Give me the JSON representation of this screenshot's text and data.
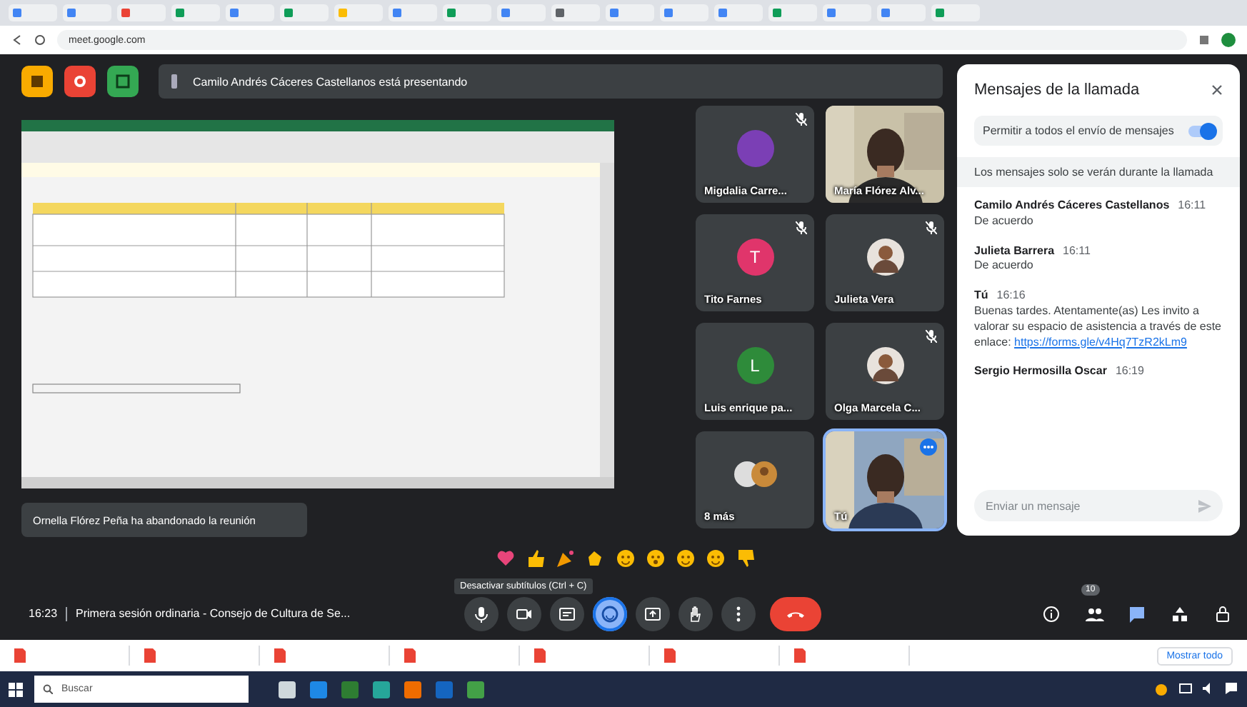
{
  "browser": {
    "url": "meet.google.com"
  },
  "presenting_banner": "Camilo Andrés Cáceres Castellanos está presentando",
  "tiles": [
    {
      "name": "Migdalia Carre...",
      "kind": "avatar",
      "color": "#7b3fb5",
      "muted": true
    },
    {
      "name": "María Flórez Alv...",
      "kind": "video",
      "muted": false
    },
    {
      "name": "Tito Farnes",
      "kind": "avatar",
      "initial": "T",
      "color": "#e0356b",
      "muted": true
    },
    {
      "name": "Julieta Vera",
      "muted": true
    },
    {
      "name": "Luis enrique pa...",
      "kind": "avatar",
      "initial": "L",
      "color": "#2e8b3a",
      "muted": false
    },
    {
      "name": "Olga Marcela C...",
      "muted": true
    },
    {
      "name": "8 más",
      "kind": "more",
      "muted": false
    },
    {
      "name": "Tú",
      "kind": "self",
      "muted": false
    }
  ],
  "notification": "Ornella Flórez Peña ha abandonado la reunión",
  "tooltip": "Desactivar subtítulos (Ctrl + C)",
  "meeting": {
    "time": "16:23",
    "title": "Primera sesión ordinaria - Consejo de Cultura de Se..."
  },
  "controls": [
    {
      "kind": "mic",
      "active": false
    },
    {
      "kind": "camera",
      "active": false
    },
    {
      "kind": "captions",
      "active": false
    },
    {
      "kind": "reactions",
      "active": true
    },
    {
      "kind": "present",
      "active": false
    },
    {
      "kind": "hand",
      "active": false
    },
    {
      "kind": "more",
      "active": false
    },
    {
      "kind": "end",
      "active": false
    }
  ],
  "side_buttons": [
    {
      "kind": "info",
      "active": false
    },
    {
      "kind": "people",
      "active": false,
      "badge": "10"
    },
    {
      "kind": "chat",
      "active": true
    },
    {
      "kind": "activities",
      "active": false
    },
    {
      "kind": "lock",
      "active": false
    }
  ],
  "chat": {
    "title": "Mensajes de la llamada",
    "allow_label": "Permitir a todos el envío de mensajes",
    "allow_on": true,
    "notice": "Los mensajes solo se verán durante la llamada",
    "messages": [
      {
        "sender": "Camilo Andrés Cáceres Castellanos",
        "time": "16:11",
        "text": "De acuerdo"
      },
      {
        "sender": "Julieta Barrera",
        "time": "16:11",
        "text": "De acuerdo"
      },
      {
        "sender": "Tú",
        "time": "16:16",
        "text": "Buenas tardes. Atentamente(as) Les invito a valorar su espacio de asistencia a través de este enlace:",
        "link": "https://forms.gle/v4Hq7TzR2kLm9"
      },
      {
        "sender": "Sergio Hermosilla Oscar",
        "time": "16:19"
      }
    ],
    "placeholder": "Enviar un mensaje"
  },
  "downloads": {
    "show_all": "Mostrar todo"
  },
  "taskbar": {
    "search_placeholder": "Buscar"
  }
}
